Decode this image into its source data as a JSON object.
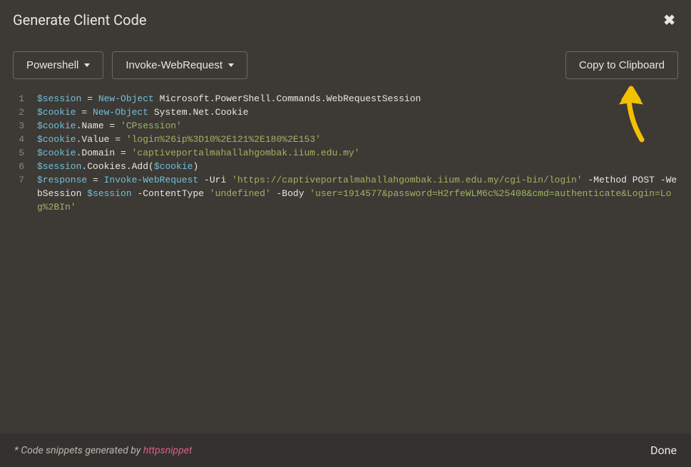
{
  "header": {
    "title": "Generate Client Code"
  },
  "toolbar": {
    "language_label": "Powershell",
    "variant_label": "Invoke-WebRequest",
    "copy_label": "Copy to Clipboard"
  },
  "code": {
    "lines": [
      {
        "n": "1",
        "html": "<span class='tok-var'>$session</span> = <span class='tok-keyword'>New-Object</span> Microsoft.PowerShell.Commands.WebRequestSession"
      },
      {
        "n": "2",
        "html": "<span class='tok-var'>$cookie</span> = <span class='tok-keyword'>New-Object</span> System.Net.Cookie"
      },
      {
        "n": "3",
        "html": "<span class='tok-var'>$cookie</span>.Name = <span class='tok-string'>'CPsession'</span>"
      },
      {
        "n": "4",
        "html": "<span class='tok-var'>$cookie</span>.Value = <span class='tok-string'>'login%26ip%3D10%2E121%2E180%2E153'</span>"
      },
      {
        "n": "5",
        "html": "<span class='tok-var'>$cookie</span>.Domain = <span class='tok-string'>'captiveportalmahallahgombak.iium.edu.my'</span>"
      },
      {
        "n": "6",
        "html": "<span class='tok-var'>$session</span>.Cookies.Add(<span class='tok-var'>$cookie</span>)"
      },
      {
        "n": "7",
        "html": "<span class='tok-var'>$response</span> = <span class='tok-keyword'>Invoke-WebRequest</span> -Uri <span class='tok-string'>'https://captiveportalmahallahgombak.iium.edu.my/cgi-bin/login'</span> -Method POST -WebSession <span class='tok-var'>$session</span> -ContentType <span class='tok-string'>'undefined'</span> -Body <span class='tok-string'>'user=1914577&password=H2rfeWLM6c%25408&cmd=authenticate&Login=Log%2BIn'</span>"
      }
    ]
  },
  "footer": {
    "prefix": "* Code snippets generated by ",
    "link": "httpsnippet",
    "done": "Done"
  }
}
